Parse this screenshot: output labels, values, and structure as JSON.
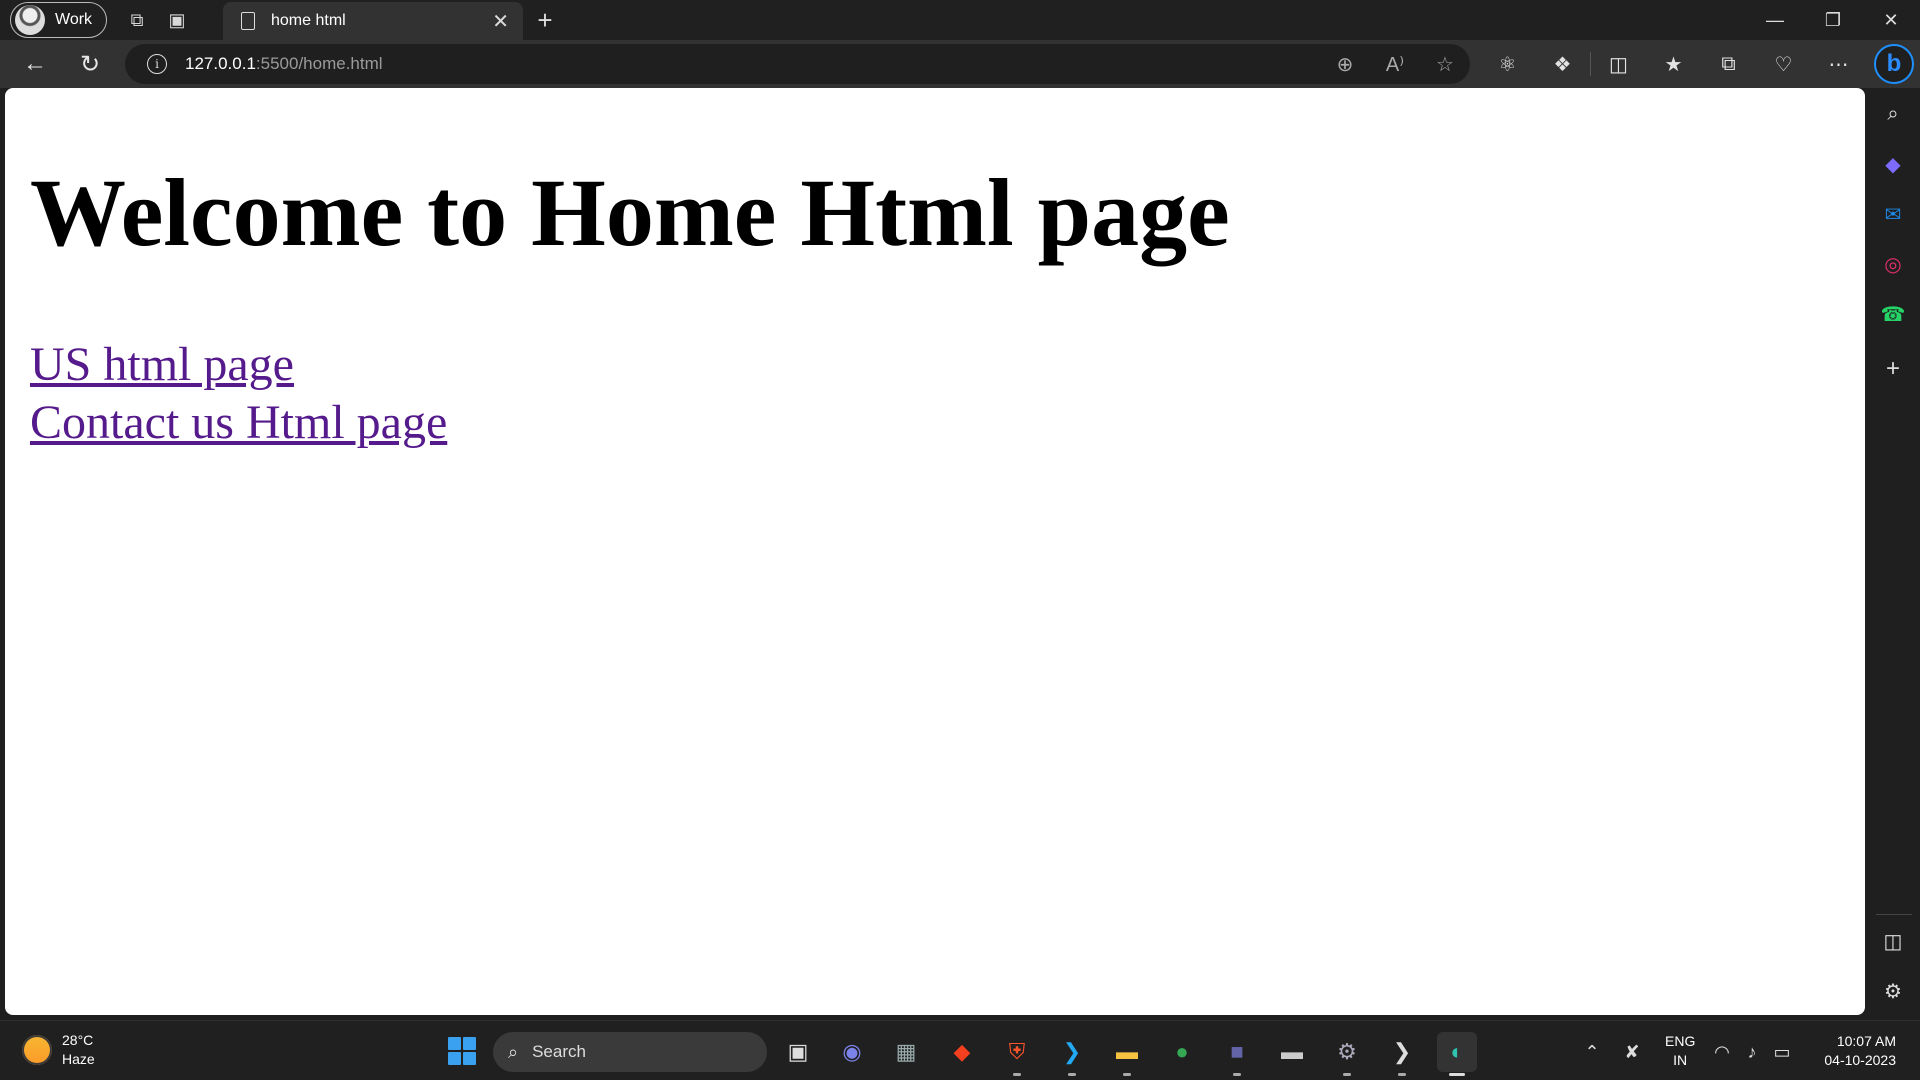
{
  "browser": {
    "profile_label": "Work",
    "tab_title": "home html",
    "url_host": "127.0.0.1",
    "url_rest": ":5500/home.html"
  },
  "page": {
    "heading": "Welcome to Home Html page",
    "links": [
      {
        "label": "US html page"
      },
      {
        "label": "Contact us Html page"
      }
    ]
  },
  "taskbar": {
    "weather_temp": "28°C",
    "weather_desc": "Haze",
    "search_label": "Search",
    "lang_top": "ENG",
    "lang_bottom": "IN",
    "time": "10:07 AM",
    "date": "04-10-2023"
  },
  "colors": {
    "link_visited": "#551a8b",
    "accent": "#1e90ff"
  }
}
